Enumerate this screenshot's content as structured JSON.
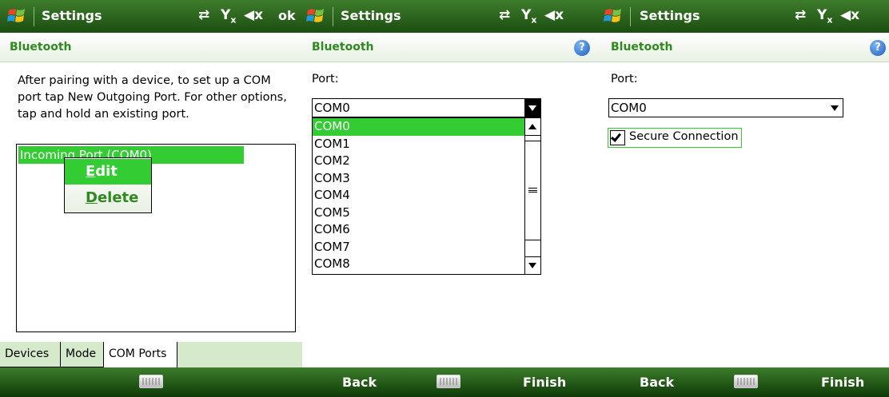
{
  "screens": [
    {
      "title": "Settings",
      "status": {
        "sync": "⇄",
        "signal": "Y",
        "signal_sub": "x",
        "volume": "◀x",
        "ok": "ok"
      },
      "header": "Bluetooth",
      "instruction": "After pairing with a device, to set up a COM port tap New Outgoing Port. For other options, tap and hold an existing port.",
      "port_item": "Incoming Port (COM0)",
      "context_menu": {
        "edit_prefix": "",
        "edit_mnemonic": "E",
        "edit_rest": "dit",
        "delete_mnemonic": "D",
        "delete_rest": "elete"
      },
      "tabs": [
        "Devices",
        "Mode",
        "COM Ports"
      ],
      "active_tab": "COM Ports",
      "softkeys": {
        "left": "",
        "right": ""
      }
    },
    {
      "title": "Settings",
      "status": {
        "sync": "⇄",
        "signal": "Y",
        "signal_sub": "x",
        "volume": "◀x"
      },
      "header": "Bluetooth",
      "help": "?",
      "port_label": "Port:",
      "combo_value": "COM0",
      "options": [
        "COM0",
        "COM1",
        "COM2",
        "COM3",
        "COM4",
        "COM5",
        "COM6",
        "COM7",
        "COM8"
      ],
      "selected_option": "COM0",
      "softkeys": {
        "left": "Back",
        "right": "Finish"
      }
    },
    {
      "title": "Settings",
      "status": {
        "sync": "⇄",
        "signal": "Y",
        "signal_sub": "x",
        "volume": "◀x"
      },
      "header": "Bluetooth",
      "help": "?",
      "port_label": "Port:",
      "combo_value": "COM0",
      "checkbox_label": "Secure Connection",
      "checkbox_checked": true,
      "softkeys": {
        "left": "Back",
        "right": "Finish"
      }
    }
  ],
  "colors": {
    "accent": "#33cc33",
    "header_text": "#2e8a1f",
    "bar_dark": "#1c4d12",
    "bar_light": "#3d7d2b",
    "tab_area": "#d4eacb"
  },
  "icons": [
    "windows-logo-icon",
    "sync-icon",
    "signal-icon",
    "volume-mute-icon",
    "help-icon",
    "keyboard-icon"
  ]
}
